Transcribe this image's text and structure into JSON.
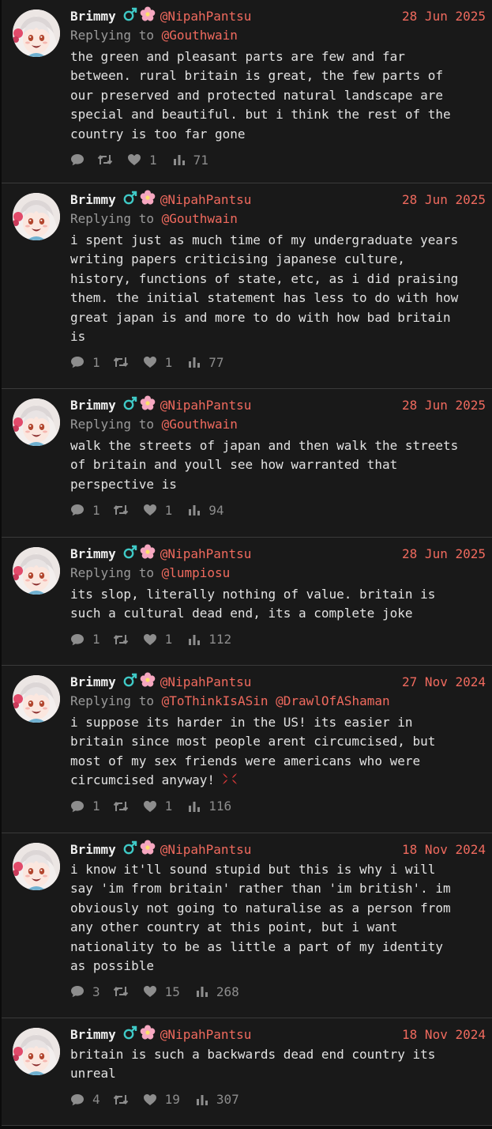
{
  "colors": {
    "background": "#191919",
    "accent": "#f06a5e",
    "muted": "#8d8d8d",
    "male_symbol": "#3fc9c6"
  },
  "icons": [
    "avatar",
    "male-sign-icon",
    "cherry-blossom-icon",
    "comment-icon",
    "retweet-icon",
    "heart-icon",
    "views-icon",
    "anger-icon"
  ],
  "tweets": [
    {
      "name": "Brimmy",
      "handle": "@NipahPantsu",
      "date": "28 Jun 2025",
      "replying_prefix": "Replying to",
      "replying_to": [
        "@Gouthwain"
      ],
      "lines": [
        "the green and pleasant parts are few and far",
        "between. rural britain is great, the few parts of",
        "our preserved and protected natural landscape are",
        "special and beautiful. but i think the rest of the",
        "country is too far gone"
      ],
      "replies": "",
      "likes": "1",
      "views": "71"
    },
    {
      "name": "Brimmy",
      "handle": "@NipahPantsu",
      "date": "28 Jun 2025",
      "replying_prefix": "Replying to",
      "replying_to": [
        "@Gouthwain"
      ],
      "lines": [
        "i spent just as much time of my undergraduate years",
        "writing papers criticising japanese culture,",
        "history, functions of state, etc, as i did praising",
        "them. the initial statement has less to do with how",
        "great japan is and more to do with how bad britain",
        "is"
      ],
      "replies": "1",
      "likes": "1",
      "views": "77"
    },
    {
      "name": "Brimmy",
      "handle": "@NipahPantsu",
      "date": "28 Jun 2025",
      "replying_prefix": "Replying to",
      "replying_to": [
        "@Gouthwain"
      ],
      "lines": [
        "walk the streets of japan and then walk the streets",
        "of britain and youll see how warranted that",
        "perspective is"
      ],
      "replies": "1",
      "likes": "1",
      "views": "94"
    },
    {
      "name": "Brimmy",
      "handle": "@NipahPantsu",
      "date": "28 Jun 2025",
      "replying_prefix": "Replying to",
      "replying_to": [
        "@lumpiosu"
      ],
      "lines": [
        "its slop, literally nothing of value. britain is",
        "such a cultural dead end, its a complete joke"
      ],
      "replies": "1",
      "likes": "1",
      "views": "112"
    },
    {
      "name": "Brimmy",
      "handle": "@NipahPantsu",
      "date": "27 Nov 2024",
      "replying_prefix": "Replying to",
      "replying_to": [
        "@ToThinkIsASin",
        "@DrawlOfAShaman"
      ],
      "lines": [
        "i suppose its harder in the US! its easier in",
        "britain since most people arent circumcised, but",
        "most of my sex friends were americans who were",
        "circumcised anyway!"
      ],
      "trailing_emoji": "anger-icon",
      "replies": "1",
      "likes": "1",
      "views": "116"
    },
    {
      "name": "Brimmy",
      "handle": "@NipahPantsu",
      "date": "18 Nov 2024",
      "replying_prefix": "",
      "replying_to": [],
      "lines": [
        "i know it'll sound stupid but this is why i will",
        "say 'im from britain' rather than 'im british'. im",
        "obviously not going to naturalise as a person from",
        "any other country at this point, but i want",
        "nationality to be as little a part of my identity",
        "as possible"
      ],
      "replies": "3",
      "likes": "15",
      "views": "268"
    },
    {
      "name": "Brimmy",
      "handle": "@NipahPantsu",
      "date": "18 Nov 2024",
      "replying_prefix": "",
      "replying_to": [],
      "lines": [
        "britain is such a backwards dead end country its",
        "unreal"
      ],
      "replies": "4",
      "likes": "19",
      "views": "307"
    }
  ]
}
